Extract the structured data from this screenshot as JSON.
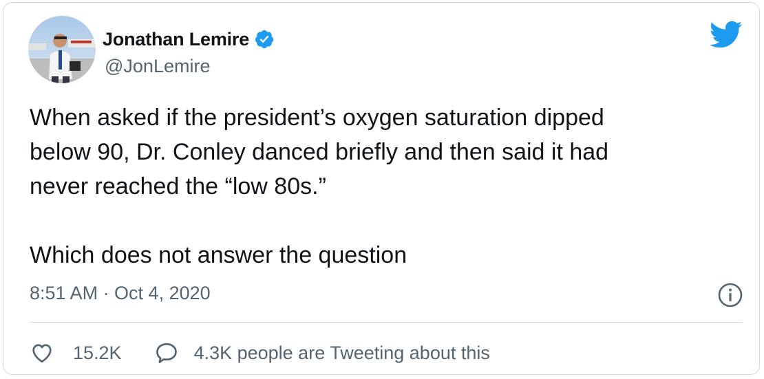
{
  "author": {
    "name": "Jonathan Lemire",
    "handle": "@JonLemire",
    "verified": true,
    "avatar_icon": "profile-photo"
  },
  "tweet": {
    "text": "When asked if the president’s oxygen saturation dipped\nbelow 90, Dr. Conley danced briefly and then said it had\nnever reached the “low 80s.”\n\nWhich does not answer the question",
    "timestamp": "8:51 AM · Oct 4, 2020"
  },
  "actions": {
    "like_count": "15.2K",
    "conversation_label": "4.3K people are Tweeting about this"
  },
  "icons": {
    "brand": "twitter-bird-icon",
    "info": "info-icon",
    "like": "heart-icon",
    "reply": "speech-bubble-icon",
    "verified": "verified-badge-icon"
  },
  "colors": {
    "brand": "#1d9bf0",
    "text": "#0f1419",
    "secondary": "#536471",
    "border": "#cfd9de"
  }
}
